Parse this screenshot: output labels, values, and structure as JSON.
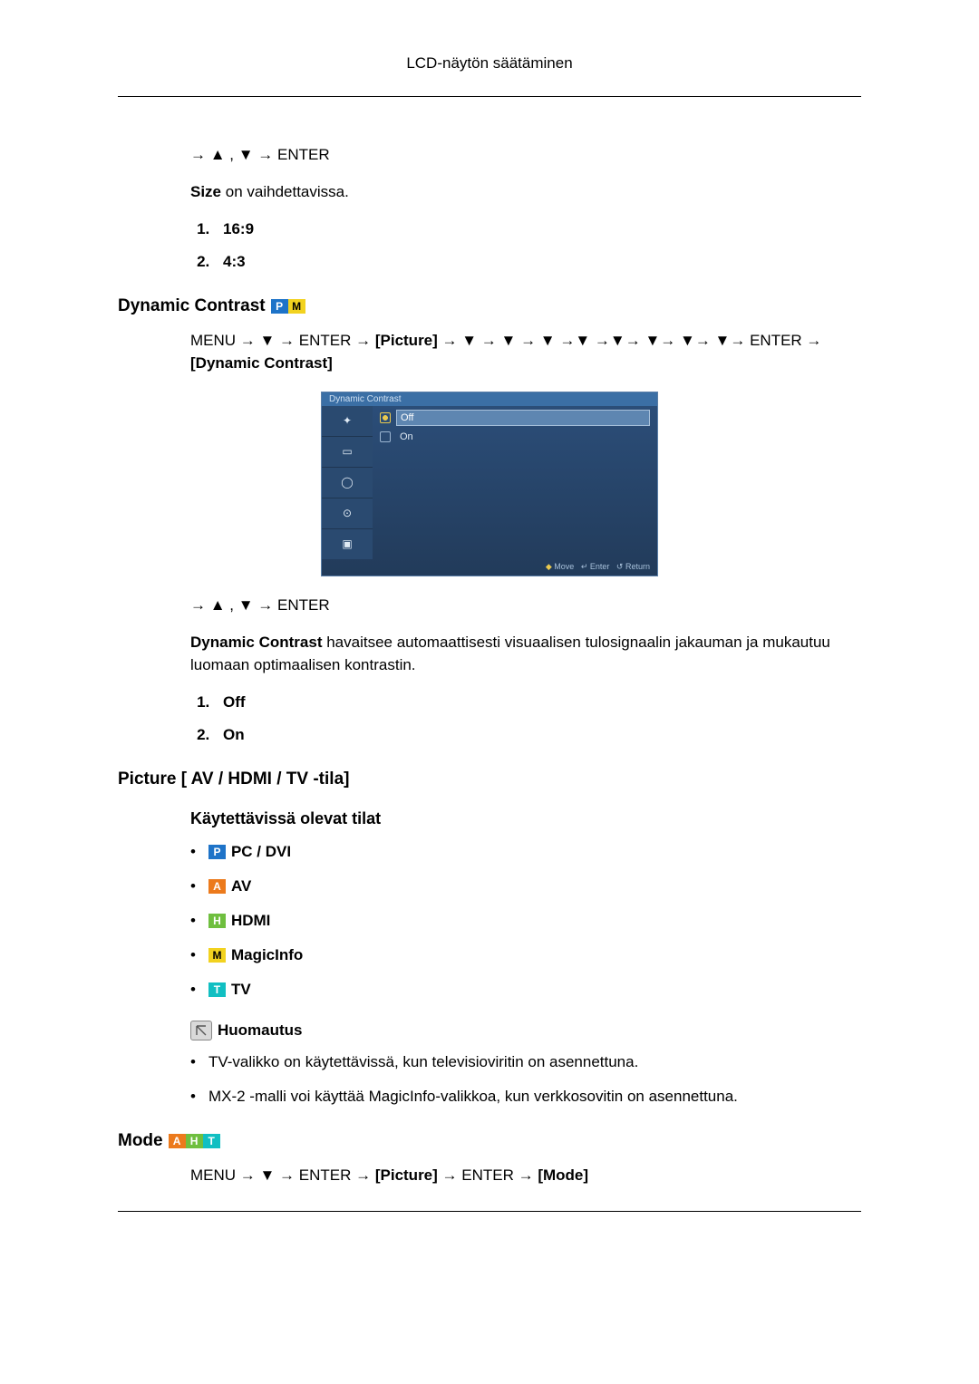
{
  "header": {
    "title": "LCD-näytön säätäminen"
  },
  "size_section": {
    "nav": "→ ▲ , ▼ → ENTER",
    "desc_prefix_bold": "Size",
    "desc_rest": " on vaihdettavissa.",
    "items": [
      "16:9",
      "4:3"
    ]
  },
  "dynamic_contrast": {
    "heading": "Dynamic Contrast",
    "badges": [
      "P",
      "M"
    ],
    "menu_path_prefix": "MENU → ▼ → ENTER → ",
    "menu_path_picture": "[Picture]",
    "menu_path_mid": " → ▼ → ▼ → ▼ →▼ →▼→ ▼→ ▼→ ▼→ ENTER → ",
    "menu_path_option": "[Dynamic Contrast]",
    "nav2": "→ ▲ , ▼ → ENTER",
    "desc_prefix_bold": "Dynamic Contrast",
    "desc_rest": " havaitsee automaattisesti visuaalisen tulosignaalin jakauman ja mukautuu luomaan optimaalisen kontrastin.",
    "items": [
      "Off",
      "On"
    ],
    "osd": {
      "title": "Dynamic Contrast",
      "options": [
        "Off",
        "On"
      ],
      "selected_index": 0,
      "footer": {
        "move": "Move",
        "enter": "Enter",
        "ret": "Return"
      }
    }
  },
  "picture_modes": {
    "heading": "Picture [ AV / HDMI / TV -tila]",
    "sub": "Käytettävissä olevat tilat",
    "modes": [
      {
        "letter": "P",
        "class": "badge-p",
        "label": "PC / DVI"
      },
      {
        "letter": "A",
        "class": "badge-a",
        "label": "AV"
      },
      {
        "letter": "H",
        "class": "badge-h",
        "label": "HDMI"
      },
      {
        "letter": "M",
        "class": "badge-m",
        "label": "MagicInfo"
      },
      {
        "letter": "T",
        "class": "badge-t",
        "label": "TV"
      }
    ],
    "note_label": "Huomautus",
    "notes": [
      "TV-valikko on käytettävissä, kun televisioviritin on asennettuna.",
      "MX-2 -malli voi käyttää MagicInfo-valikkoa, kun verkkosovitin on asennettuna."
    ]
  },
  "mode_section": {
    "heading": "Mode",
    "badges": [
      "A",
      "H",
      "T"
    ],
    "menu_path": "MENU → ▼ → ENTER → [Picture] → ENTER → [Mode]"
  }
}
